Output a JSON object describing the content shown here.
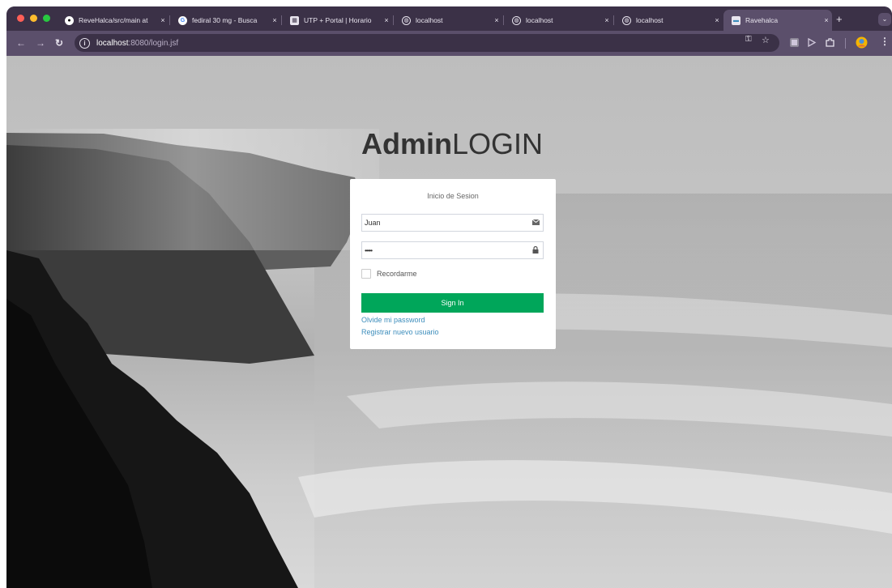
{
  "browser": {
    "tabs": [
      {
        "title": "ReveHalca/src/main at",
        "icon": "github-icon",
        "active": false
      },
      {
        "title": "fediral 30 mg - Busca",
        "icon": "google-icon",
        "active": false
      },
      {
        "title": "UTP + Portal | Horario",
        "icon": "utp-icon",
        "active": false
      },
      {
        "title": "localhost",
        "icon": "globe-icon",
        "active": false
      },
      {
        "title": "localhost",
        "icon": "globe-icon",
        "active": false
      },
      {
        "title": "localhost",
        "icon": "globe-icon",
        "active": false
      },
      {
        "title": "Ravehalca",
        "icon": "page-icon",
        "active": true
      }
    ],
    "tab_close_glyph": "×",
    "new_tab_glyph": "+",
    "url_host": "localhost",
    "url_path": ":8080/login.jsf"
  },
  "login": {
    "brand_bold": "Admin",
    "brand_light": "LOGIN",
    "box_message": "Inicio de Sesion",
    "username_value": "Juan",
    "password_value": "•••••",
    "remember_label": "Recordarme",
    "sign_in_label": "Sign In",
    "forgot_link": "Olvide mi password",
    "register_link": "Registrar nuevo usuario"
  },
  "colors": {
    "browser_frame": "#3b3147",
    "toolbar": "#5b4f6b",
    "sign_in_button": "#00a65a",
    "link": "#3c8dbc"
  }
}
